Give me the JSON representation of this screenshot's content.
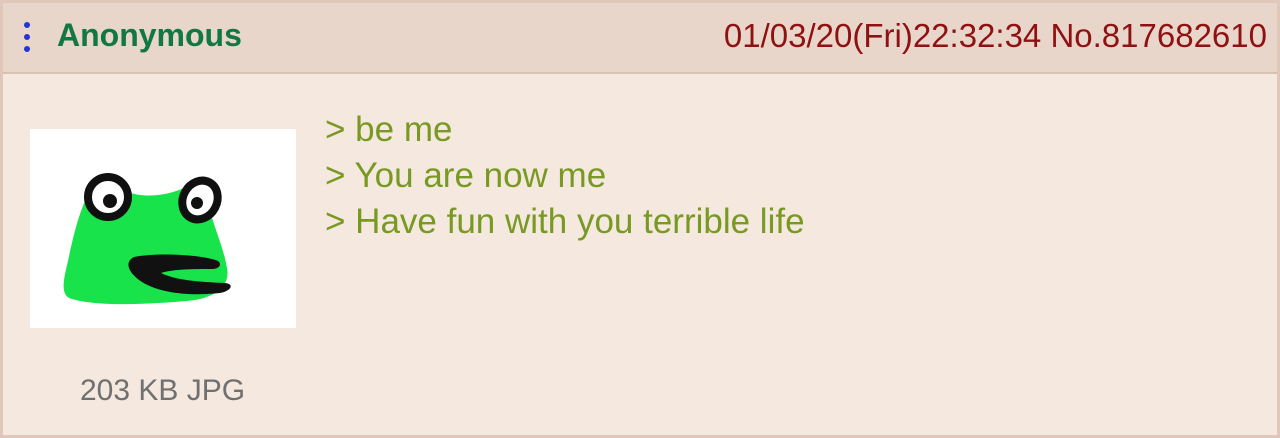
{
  "post": {
    "name": "Anonymous",
    "datetime_and_id": "01/03/20(Fri)22:32:34 No.817682610",
    "lines": [
      "> be me",
      "> You are now me",
      "> Have fun with you terrible life"
    ],
    "file_info": "203 KB JPG"
  },
  "icons": {
    "menu": "vertical-dots-icon",
    "thumbnail": "frog-drawing"
  },
  "colors": {
    "name": "#117743",
    "meta": "#8f1111",
    "greentext": "#789922",
    "header_bg": "#e9d6cb",
    "post_bg": "#f5e8df",
    "menu": "#2434d6",
    "frog": "#19e34a"
  }
}
